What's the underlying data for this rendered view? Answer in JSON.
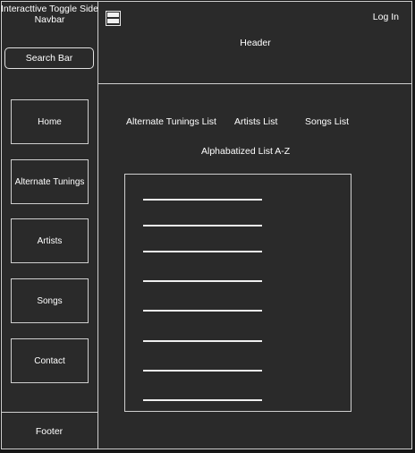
{
  "sidebar": {
    "title": "Interacttive Toggle Side Navbar",
    "search_label": "Search Bar",
    "items": [
      {
        "label": "Home"
      },
      {
        "label": "Alternate Tunings"
      },
      {
        "label": "Artists"
      },
      {
        "label": "Songs"
      },
      {
        "label": "Contact"
      }
    ],
    "footer": "Footer"
  },
  "header": {
    "title": "Header",
    "login": "Log In",
    "menu_icon": "hamburger-menu-icon"
  },
  "main": {
    "tabs": [
      {
        "label": "Alternate Tunings List"
      },
      {
        "label": "Artists List"
      },
      {
        "label": "Songs List"
      }
    ],
    "list_title": "Alphabatized List A-Z",
    "list_item_count": 8
  }
}
